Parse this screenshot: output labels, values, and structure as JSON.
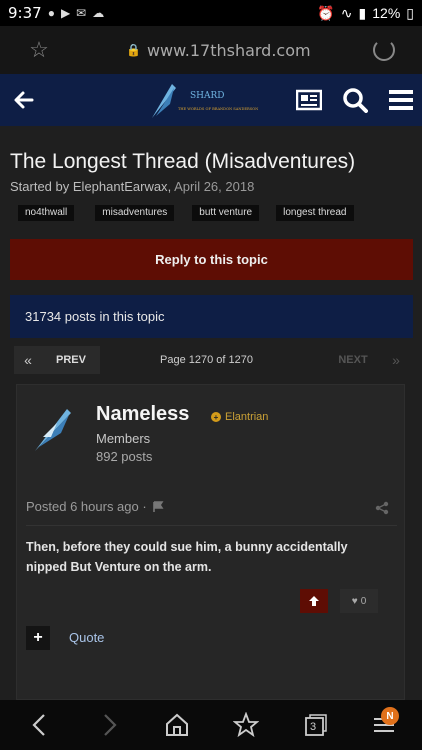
{
  "status": {
    "time": "9:37",
    "battery": "12%"
  },
  "browser": {
    "url": "www.17thshard.com"
  },
  "site": {
    "logo_text": "SHARD",
    "logo_subtext": "THE WORLDS OF BRANDON SANDERSON"
  },
  "topic": {
    "title": "The Longest Thread (Misadventures)",
    "started_by_prefix": "Started by",
    "author": "ElephantEarwax",
    "date": "April 26, 2018",
    "tags": [
      "no4thwall",
      "misadventures",
      "butt venture",
      "longest thread"
    ],
    "reply_label": "Reply to this topic",
    "post_count_text": "31734 posts in this topic"
  },
  "pagination": {
    "first_symbol": "«",
    "prev_label": "PREV",
    "page_info": "Page 1270 of 1270",
    "next_label": "NEXT",
    "last_symbol": "»"
  },
  "post": {
    "author": "Nameless",
    "rank": "Elantrian",
    "group": "Members",
    "post_count": "892 posts",
    "posted": "Posted 6 hours ago ·",
    "body": "Then, before they could sue him, a bunny accidentally nipped But Venture on the arm.",
    "like_count": "0",
    "quote_label": "Quote",
    "add_symbol": "+"
  },
  "bottom_nav": {
    "tabs_count": "3",
    "menu_badge": "N"
  },
  "colors": {
    "accent_red": "#5e0d04",
    "navy": "#0e1e45",
    "rank_gold": "#c9a036"
  }
}
